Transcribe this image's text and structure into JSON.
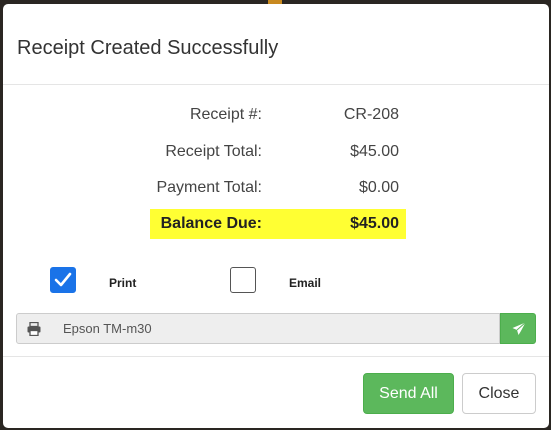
{
  "modal": {
    "title": "Receipt Created Successfully"
  },
  "summary": {
    "receipt_number_label": "Receipt #:",
    "receipt_number_value": "CR-208",
    "receipt_total_label": "Receipt Total:",
    "receipt_total_value": "$45.00",
    "payment_total_label": "Payment Total:",
    "payment_total_value": "$0.00",
    "balance_due_label": "Balance Due:",
    "balance_due_value": "$45.00"
  },
  "options": {
    "print_label": "Print",
    "print_checked": true,
    "email_label": "Email",
    "email_checked": false
  },
  "printer": {
    "value": "Epson TM-m30",
    "icon": "printer-icon",
    "send_icon": "paper-plane-icon"
  },
  "footer": {
    "send_all_label": "Send All",
    "close_label": "Close"
  },
  "colors": {
    "highlight": "#ffff33",
    "success": "#5cb85c",
    "checkbox_accent": "#1a73e8"
  }
}
